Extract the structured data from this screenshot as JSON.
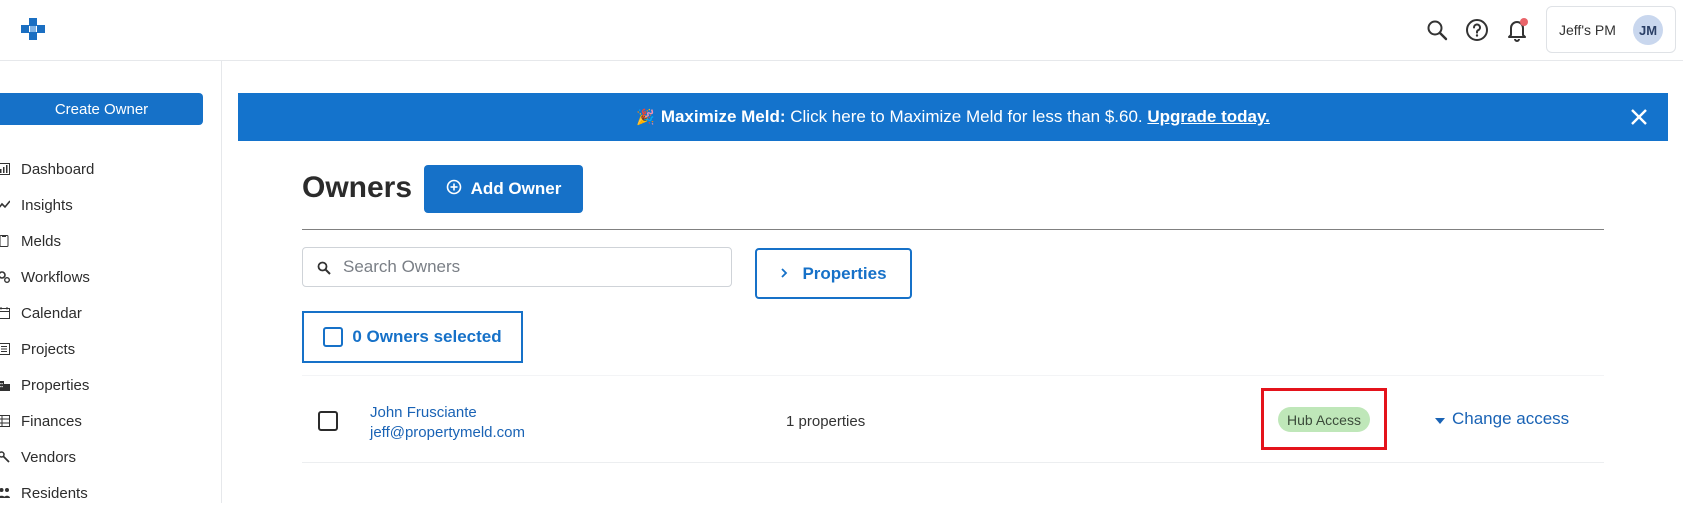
{
  "header": {
    "org_name": "Jeff's PM",
    "avatar_initials": "JM",
    "icons": [
      "logo-icon",
      "search-icon",
      "help-icon",
      "bell-icon"
    ]
  },
  "sidebar": {
    "create_button": "Create Owner",
    "items": [
      {
        "label": "Dashboard",
        "icon": "dashboard-icon"
      },
      {
        "label": "Insights",
        "icon": "insights-icon"
      },
      {
        "label": "Melds",
        "icon": "melds-icon"
      },
      {
        "label": "Workflows",
        "icon": "workflows-icon"
      },
      {
        "label": "Calendar",
        "icon": "calendar-icon"
      },
      {
        "label": "Projects",
        "icon": "projects-icon"
      },
      {
        "label": "Properties",
        "icon": "properties-icon"
      },
      {
        "label": "Finances",
        "icon": "finances-icon"
      },
      {
        "label": "Vendors",
        "icon": "vendors-icon"
      },
      {
        "label": "Residents",
        "icon": "residents-icon"
      }
    ]
  },
  "banner": {
    "emoji": "🎉",
    "bold_text": "Maximize Meld:",
    "text": " Click here to Maximize Meld for less than $.60. ",
    "link_text": "Upgrade today."
  },
  "main": {
    "title": "Owners",
    "add_button": "Add Owner",
    "search_placeholder": "Search Owners",
    "properties_button": "Properties",
    "selection_label": "0 Owners selected",
    "rows": [
      {
        "name": "John Frusciante",
        "email": "jeff@propertymeld.com",
        "properties": "1 properties",
        "badge": "Hub Access",
        "action": "Change access"
      }
    ]
  },
  "colors": {
    "brand_blue": "#1671c8",
    "badge_green": "#bfe7b9",
    "highlight_red": "#e4131b"
  }
}
